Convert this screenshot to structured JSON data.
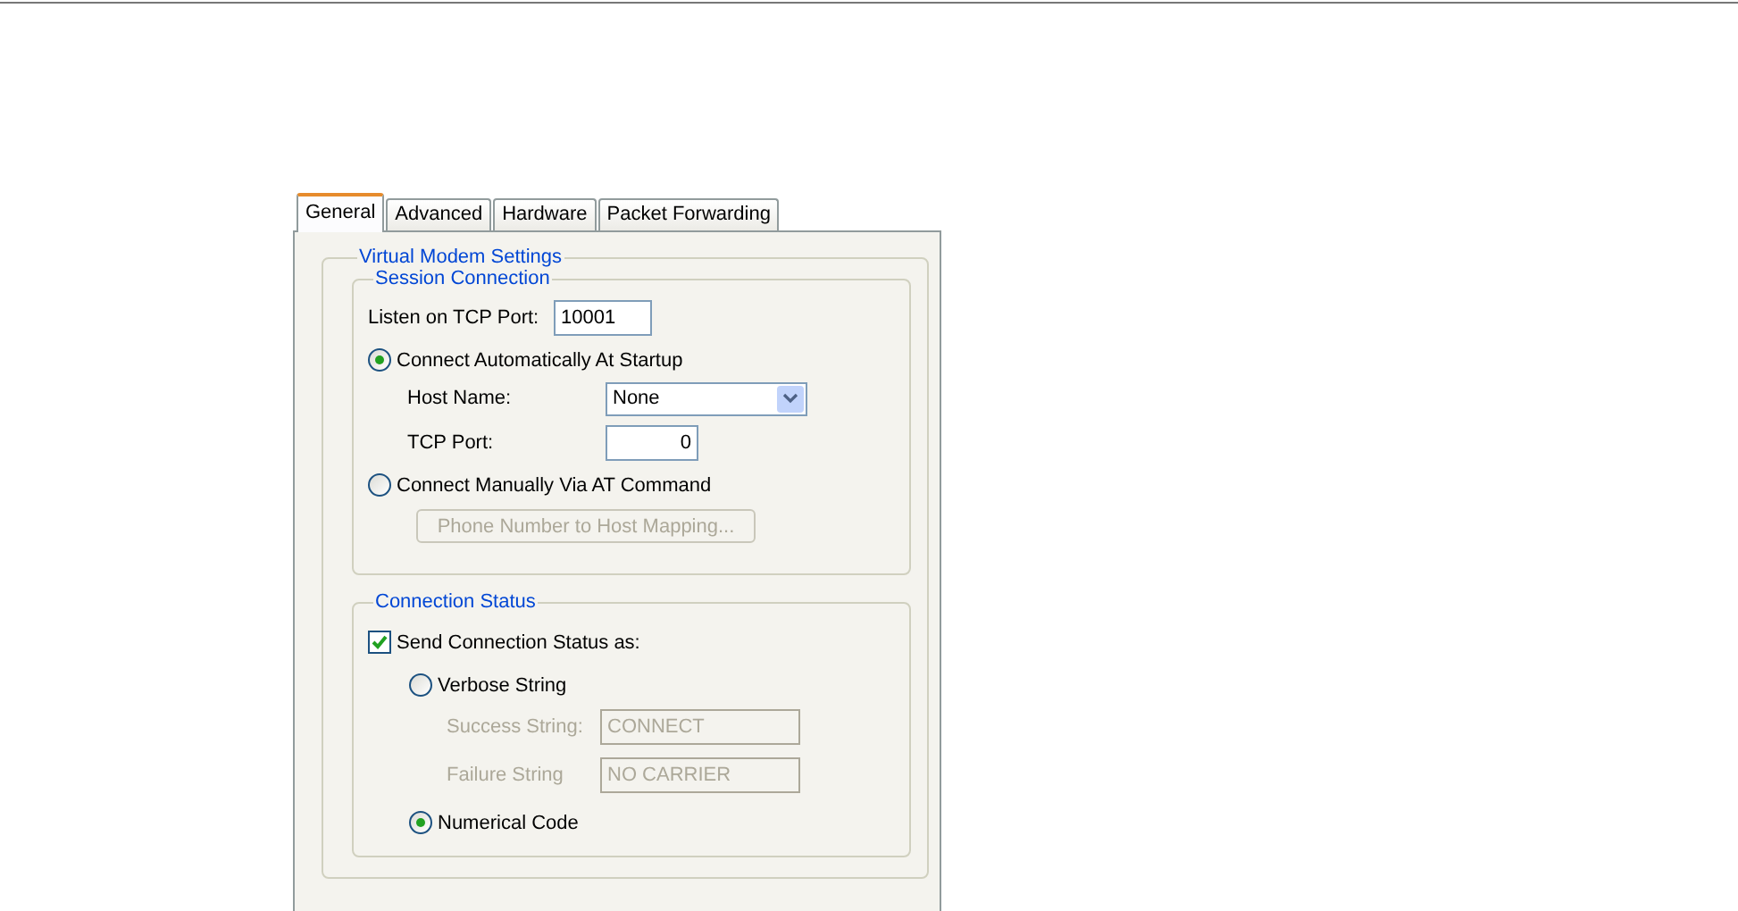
{
  "tabs": [
    {
      "label": "General",
      "selected": true
    },
    {
      "label": "Advanced",
      "selected": false
    },
    {
      "label": "Hardware",
      "selected": false
    },
    {
      "label": "Packet Forwarding",
      "selected": false
    }
  ],
  "virtual_modem_settings": {
    "title": "Virtual Modem Settings",
    "session_connection": {
      "title": "Session Connection",
      "listen_port": {
        "label": "Listen on TCP Port:",
        "value": "10001"
      },
      "auto_connect": {
        "label": "Connect Automatically At Startup",
        "selected": true
      },
      "host_name": {
        "label": "Host Name:",
        "value": "None"
      },
      "tcp_port": {
        "label": "TCP Port:",
        "value": "0"
      },
      "manual_connect": {
        "label": "Connect Manually Via AT Command",
        "selected": false
      },
      "mapping_button": {
        "label": "Phone Number to Host Mapping...",
        "disabled": true
      }
    },
    "connection_status": {
      "title": "Connection Status",
      "send_status": {
        "label": "Send Connection Status as:",
        "checked": true
      },
      "verbose": {
        "label": "Verbose String",
        "selected": false
      },
      "success_string": {
        "label": "Success String:",
        "value": "CONNECT",
        "disabled": true
      },
      "failure_string": {
        "label": "Failure String",
        "value": "NO CARRIER",
        "disabled": true
      },
      "numerical": {
        "label": "Numerical Code",
        "selected": true
      }
    }
  }
}
